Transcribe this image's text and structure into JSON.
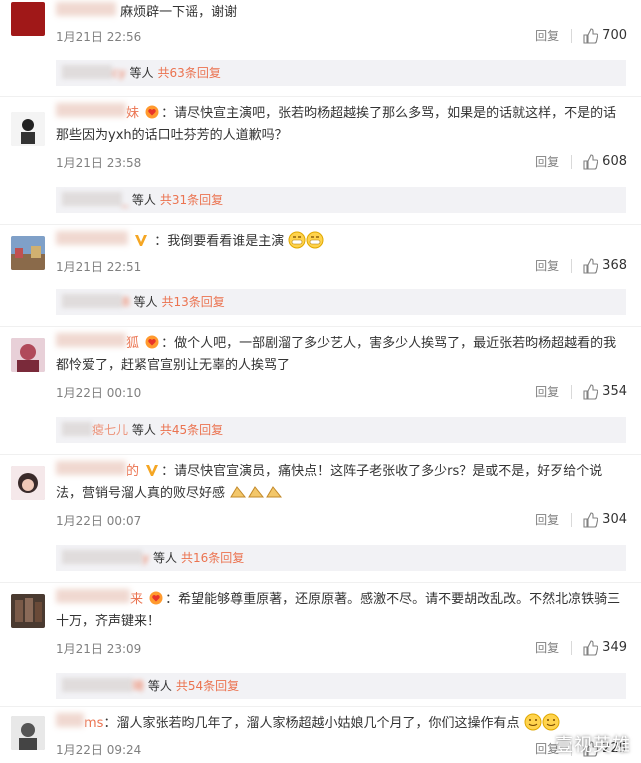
{
  "comments": [
    {
      "user": "麻烦",
      "text": "麻烦辟一下谣，谢谢",
      "time": "1月21日 22:56",
      "reply_label": "回复",
      "likes": "700",
      "sub": null
    },
    {
      "user": "cy",
      "text": "",
      "time": "",
      "reply_label": "",
      "likes": "",
      "sub": {
        "who": "cy",
        "suffix": "等人",
        "total": "共63条回复"
      }
    },
    {
      "user": "妹",
      "text": "请尽快宣主演吧，张若昀杨超越挨了那么多骂，如果是的话就这样，不是的话那些因为yxh的话口吐芬芳的人道歉吗？",
      "time": "1月21日 23:58",
      "reply_label": "回复",
      "likes": "608",
      "sub": {
        "who": "_",
        "suffix": "等人",
        "total": "共31条回复"
      }
    },
    {
      "user": "V",
      "text": "我倒要看看谁是主演",
      "time": "1月21日 22:51",
      "reply_label": "回复",
      "likes": "368",
      "sub": {
        "who": "8",
        "suffix": "等人",
        "total": "共13条回复"
      }
    },
    {
      "user": "狐",
      "text": "做个人吧，一部剧溜了多少艺人，害多少人挨骂了，最近张若昀杨超越看的我都怜爱了，赶紧官宣别让无辜的人挨骂了",
      "time": "1月22日 00:10",
      "reply_label": "回复",
      "likes": "354",
      "sub": {
        "who": "瘪七儿",
        "suffix": "等人",
        "total": "共45条回复"
      }
    },
    {
      "user": "的",
      "text": "请尽快官宣演员，痛快点！这阵子老张收了多少rs？是或不是，好歹给个说法，营销号溜人真的败尽好感",
      "time": "1月22日 00:07",
      "reply_label": "回复",
      "likes": "304",
      "sub": {
        "who": "y",
        "suffix": "等人",
        "total": "共16条回复"
      }
    },
    {
      "user": "来",
      "text": "希望能够尊重原著，还原原著。感激不尽。请不要胡改乱改。不然北凉铁骑三十万，齐声键来！",
      "time": "1月21日 23:09",
      "reply_label": "回复",
      "likes": "349",
      "sub": {
        "who": "琦",
        "suffix": "等人",
        "total": "共54条回复"
      }
    },
    {
      "user": "ms",
      "text": "溜人家张若昀几年了，溜人家杨超越小姑娘几个月了，你们这操作有点",
      "time": "1月22日 09:24",
      "reply_label": "回复",
      "likes": "225",
      "sub": null
    }
  ],
  "watermark": "壹视英雄"
}
